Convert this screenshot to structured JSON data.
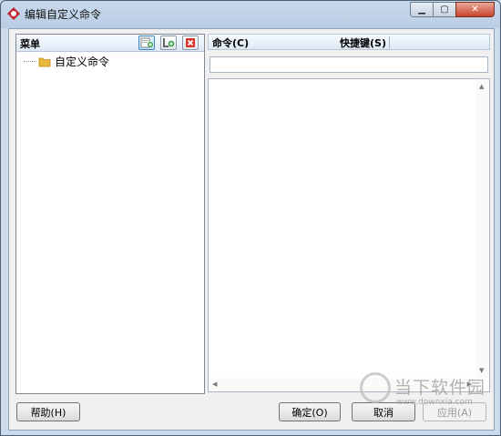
{
  "window": {
    "title": "编辑自定义命令",
    "min_label": "▁",
    "max_label": "▢",
    "close_label": "✕"
  },
  "menu_panel": {
    "header": "菜单",
    "tree": [
      {
        "label": "自定义命令"
      }
    ]
  },
  "command_panel": {
    "command_header": "命令(C)",
    "shortcut_header": "快捷键(S)",
    "input_value": ""
  },
  "buttons": {
    "help": "帮助(H)",
    "ok": "确定(O)",
    "cancel": "取消",
    "apply": "应用(A)"
  },
  "watermark": {
    "name": "当下软件园",
    "url": "www.downxia.com"
  },
  "colors": {
    "accent": "#3c86c8",
    "close": "#c7432e"
  }
}
